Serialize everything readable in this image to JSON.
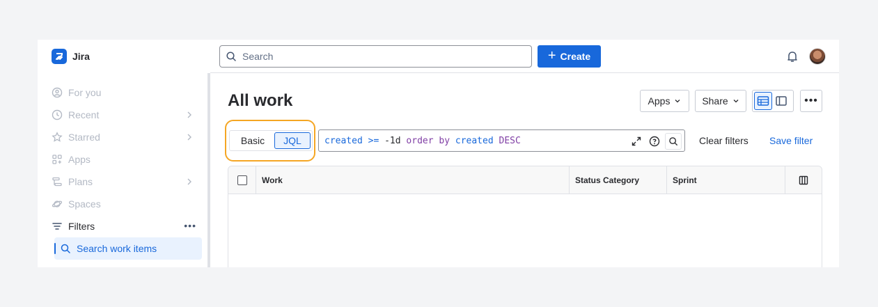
{
  "brand": {
    "name": "Jira"
  },
  "sidebar": {
    "items": [
      {
        "label": "For you",
        "icon": "person-circle-icon"
      },
      {
        "label": "Recent",
        "icon": "clock-icon"
      },
      {
        "label": "Starred",
        "icon": "star-icon"
      },
      {
        "label": "Apps",
        "icon": "apps-grid-icon"
      },
      {
        "label": "Plans",
        "icon": "plans-icon"
      },
      {
        "label": "Spaces",
        "icon": "planet-icon"
      },
      {
        "label": "Filters",
        "icon": "filter-icon"
      },
      {
        "label": "Search work items",
        "icon": "search-icon"
      }
    ]
  },
  "topbar": {
    "search_placeholder": "Search",
    "create_label": "Create"
  },
  "main": {
    "title": "All work",
    "apps_label": "Apps",
    "share_label": "Share",
    "mode": {
      "basic": "Basic",
      "jql": "JQL",
      "selected": "JQL"
    },
    "jql": {
      "field": "created",
      "operator": ">=",
      "value": "-1d",
      "kw_order": "order",
      "kw_by": "by",
      "sort_field": "created",
      "direction": "DESC"
    },
    "clear_filters": "Clear filters",
    "save_filter": "Save filter",
    "table": {
      "columns": [
        "Work",
        "Status Category",
        "Sprint"
      ]
    }
  },
  "colors": {
    "accent": "#1868db",
    "highlight": "#f5a623",
    "keyword": "#803fa5"
  }
}
